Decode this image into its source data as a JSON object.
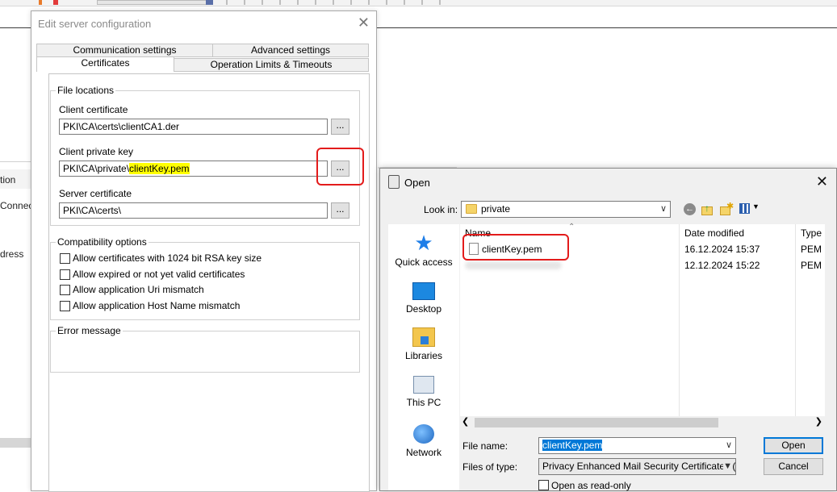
{
  "background": {
    "left_fragments": [
      "tion",
      "Connec",
      "dress"
    ]
  },
  "edit_dialog": {
    "title": "Edit server configuration",
    "close": "✕",
    "tabs": {
      "communication": "Communication settings",
      "advanced": "Advanced settings",
      "certificates": "Certificates",
      "limits": "Operation Limits & Timeouts"
    },
    "file_locations": {
      "label": "File locations",
      "client_certificate_label": "Client certificate",
      "client_certificate_value": "PKI\\CA\\certs\\clientCA1.der",
      "client_private_key_label": "Client private key",
      "client_private_key_prefix": "PKI\\CA\\private\\",
      "client_private_key_file": "clientKey.pem",
      "server_certificate_label": "Server certificate",
      "server_certificate_value": "PKI\\CA\\certs\\",
      "browse_label": "..."
    },
    "compatibility": {
      "label": "Compatibility options",
      "options": [
        "Allow certificates with 1024 bit RSA key size",
        "Allow expired or not yet valid certificates",
        "Allow application Uri mismatch",
        "Allow application Host Name mismatch"
      ]
    },
    "error_message_label": "Error message"
  },
  "open_dialog": {
    "title": "Open",
    "close": "✕",
    "look_in_label": "Look in:",
    "look_in_value": "private",
    "places": [
      "Quick access",
      "Desktop",
      "Libraries",
      "This PC",
      "Network"
    ],
    "columns": {
      "name": "Name",
      "date": "Date modified",
      "type": "Type"
    },
    "files": [
      {
        "name": "clientKey.pem",
        "date": "16.12.2024 15:37",
        "type": "PEM"
      },
      {
        "name": "",
        "date": "12.12.2024 15:22",
        "type": "PEM"
      }
    ],
    "file_name_label": "File name:",
    "file_name_value": "clientKey.pem",
    "files_of_type_label": "Files of type:",
    "files_of_type_value": "Privacy Enhanced Mail Security Certificates (*.p",
    "open_button": "Open",
    "cancel_button": "Cancel",
    "read_only_label": "Open as read-only"
  },
  "colors": {
    "highlight": "#ffff00",
    "annotation_red": "#e31b1b",
    "selection_blue": "#0078d7"
  }
}
